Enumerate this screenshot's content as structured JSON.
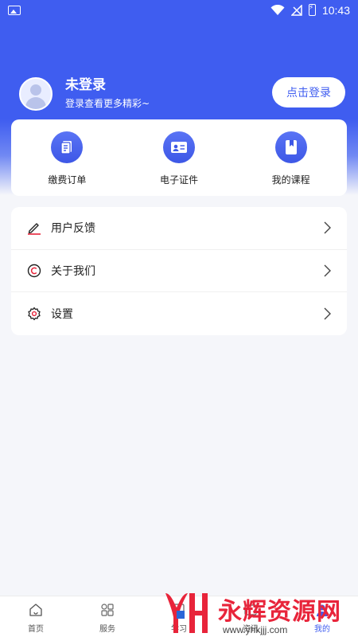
{
  "status_bar": {
    "time": "10:43"
  },
  "profile": {
    "name": "未登录",
    "subtitle": "登录查看更多精彩~",
    "login_button": "点击登录"
  },
  "quick_actions": [
    {
      "label": "缴费订单",
      "icon": "order-icon"
    },
    {
      "label": "电子证件",
      "icon": "id-card-icon"
    },
    {
      "label": "我的课程",
      "icon": "course-book-icon"
    }
  ],
  "menu": [
    {
      "label": "用户反馈",
      "icon": "pencil-icon"
    },
    {
      "label": "关于我们",
      "icon": "copyright-icon"
    },
    {
      "label": "设置",
      "icon": "gear-icon"
    }
  ],
  "bottom_nav": [
    {
      "label": "首页",
      "icon": "home-icon"
    },
    {
      "label": "服务",
      "icon": "grid-icon"
    },
    {
      "label": "学习",
      "icon": "study-icon"
    },
    {
      "label": "资讯",
      "icon": "news-icon"
    },
    {
      "label": "我的",
      "icon": "user-icon",
      "active": true
    }
  ],
  "watermark": {
    "logo_text": "永辉资源网",
    "url": "www.yhkjjj.com"
  },
  "colors": {
    "brand": "#3f5df0",
    "background": "#f5f6fa",
    "watermark": "#e8243a"
  }
}
